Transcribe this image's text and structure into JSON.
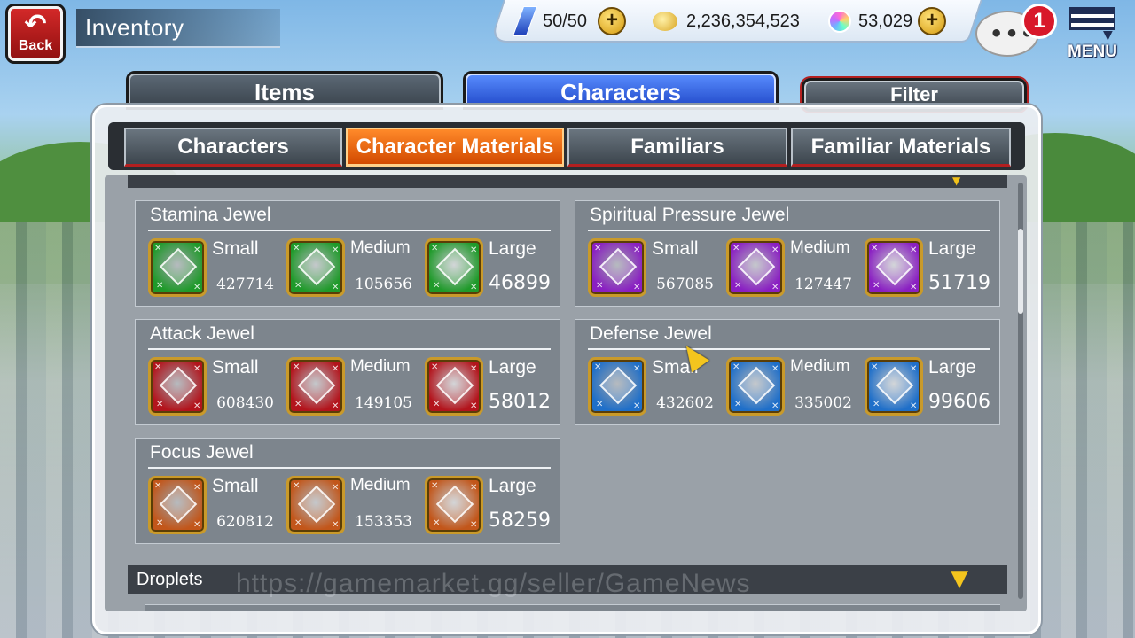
{
  "header": {
    "back_label": "Back",
    "title": "Inventory",
    "stamina": "50/50",
    "coins": "2,236,354,523",
    "spirit_orbs": "53,029",
    "chat_badge": "1",
    "menu_label": "MENU"
  },
  "main_tabs": [
    {
      "label": "Items",
      "active": false
    },
    {
      "label": "Characters",
      "active": true
    }
  ],
  "filter_label": "Filter",
  "sub_tabs": [
    {
      "label": "Characters",
      "active": false
    },
    {
      "label": "Character Materials",
      "active": true
    },
    {
      "label": "Familiars",
      "active": false
    },
    {
      "label": "Familiar Materials",
      "active": false
    }
  ],
  "jewel_groups": [
    {
      "title": "Stamina Jewel",
      "color": "#1f9a2a",
      "slots": [
        {
          "size": "Small",
          "count": "427714"
        },
        {
          "size": "Medium",
          "count": "105656"
        },
        {
          "size": "Large",
          "count": "46899"
        }
      ]
    },
    {
      "title": "Spiritual Pressure Jewel",
      "color": "#8a1fc2",
      "slots": [
        {
          "size": "Small",
          "count": "567085"
        },
        {
          "size": "Medium",
          "count": "127447"
        },
        {
          "size": "Large",
          "count": "51719"
        }
      ]
    },
    {
      "title": "Attack Jewel",
      "color": "#b3141c",
      "slots": [
        {
          "size": "Small",
          "count": "608430"
        },
        {
          "size": "Medium",
          "count": "149105"
        },
        {
          "size": "Large",
          "count": "58012"
        }
      ]
    },
    {
      "title": "Defense Jewel",
      "color": "#1f6fc9",
      "slots": [
        {
          "size": "Small",
          "count": "432602"
        },
        {
          "size": "Medium",
          "count": "335002"
        },
        {
          "size": "Large",
          "count": "99606"
        }
      ]
    },
    {
      "title": "Focus Jewel",
      "color": "#c2561a",
      "slots": [
        {
          "size": "Small",
          "count": "620812"
        },
        {
          "size": "Medium",
          "count": "153353"
        },
        {
          "size": "Large",
          "count": "58259"
        }
      ]
    }
  ],
  "droplets_label": "Droplets",
  "watermark": "https://gamemarket.gg/seller/GameNews",
  "icons": {
    "back": "back-arrow-icon",
    "stamina": "stamina-crystal-icon",
    "coin": "coin-icon",
    "orb": "spirit-orb-icon",
    "plus": "plus-icon",
    "chat": "chat-bubble-icon",
    "menu": "hamburger-menu-icon",
    "expand": "chevron-down-icon"
  }
}
